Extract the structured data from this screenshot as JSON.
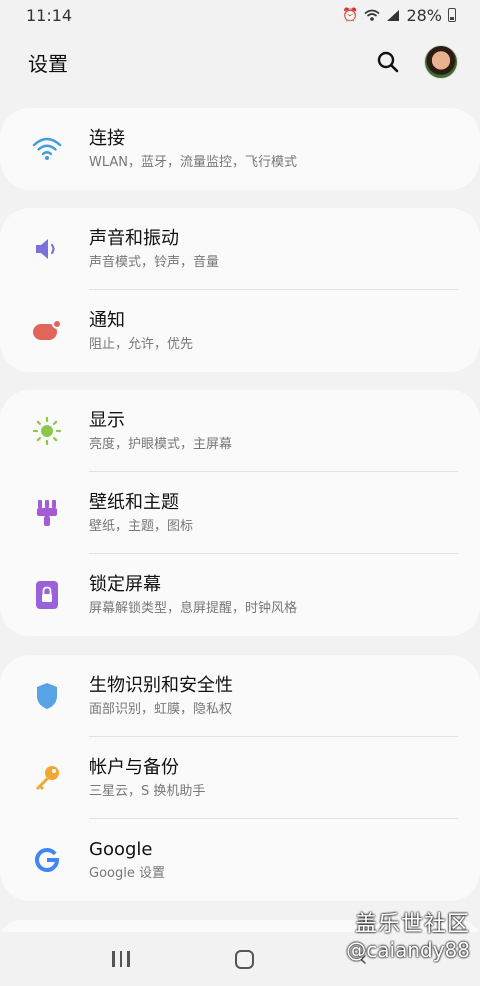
{
  "status": {
    "time": "11:14",
    "battery": "28%",
    "icons": [
      "alarm-icon",
      "wifi-icon",
      "signal-icon",
      "battery-icon"
    ]
  },
  "header": {
    "title": "设置",
    "search_icon": "search-icon"
  },
  "colors": {
    "connections": "#3f9ddc",
    "sound": "#7a72d6",
    "notifications": "#e0665c",
    "display": "#8bc84a",
    "wallpaper": "#a35bd6",
    "lock": "#9a62d9",
    "biometrics": "#5aa2e6",
    "accounts": "#f0a832",
    "google": "#4285f4"
  },
  "groups": [
    {
      "items": [
        {
          "icon": "wifi-icon",
          "title": "连接",
          "subtitle": "WLAN，蓝牙，流量监控，飞行模式"
        }
      ]
    },
    {
      "items": [
        {
          "icon": "volume-icon",
          "title": "声音和振动",
          "subtitle": "声音模式，铃声，音量"
        },
        {
          "icon": "notification-icon",
          "title": "通知",
          "subtitle": "阻止，允许，优先"
        }
      ]
    },
    {
      "items": [
        {
          "icon": "brightness-icon",
          "title": "显示",
          "subtitle": "亮度，护眼模式，主屏幕"
        },
        {
          "icon": "paint-brush-icon",
          "title": "壁纸和主题",
          "subtitle": "壁纸，主题，图标"
        },
        {
          "icon": "lock-icon",
          "title": "锁定屏幕",
          "subtitle": "屏幕解锁类型，息屏提醒，时钟风格"
        }
      ]
    },
    {
      "items": [
        {
          "icon": "shield-icon",
          "title": "生物识别和安全性",
          "subtitle": "面部识别，虹膜，隐私权"
        },
        {
          "icon": "key-icon",
          "title": "帐户与备份",
          "subtitle": "三星云，S 换机助手"
        },
        {
          "icon": "google-icon",
          "title": "Google",
          "subtitle": "Google 设置"
        }
      ]
    }
  ],
  "watermark": {
    "line1": "盖乐世社区",
    "line2": "@caiandy88"
  }
}
